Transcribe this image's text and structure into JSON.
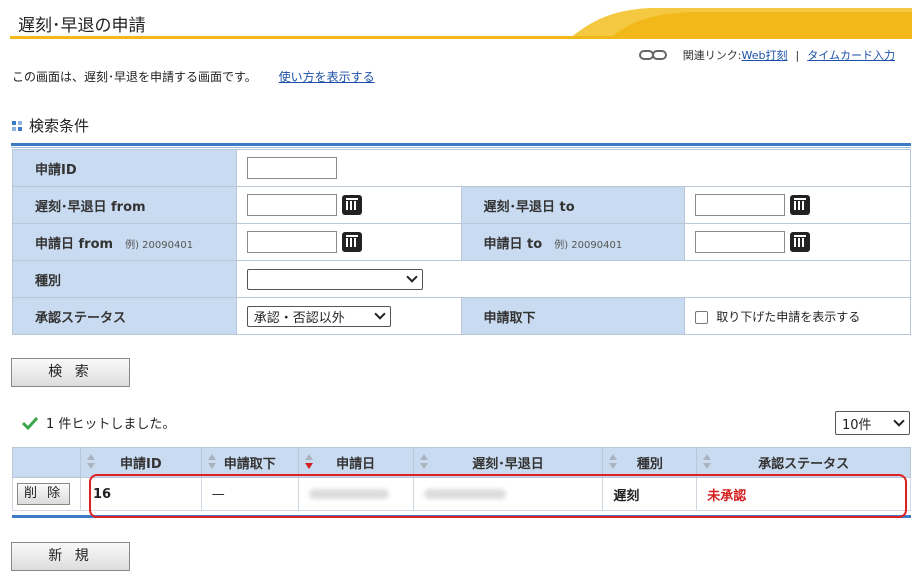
{
  "page": {
    "title": "遅刻･早退の申請",
    "description": "この画面は、遅刻･早退を申請する画面です。",
    "help_link": "使い方を表示する"
  },
  "related": {
    "label": "関連リンク:",
    "links": [
      "Web打刻",
      "タイムカード入力"
    ],
    "separator": "|"
  },
  "search": {
    "heading": "検索条件",
    "fields": {
      "request_id": {
        "label": "申請ID",
        "value": ""
      },
      "late_from": {
        "label": "遅刻･早退日 from",
        "value": ""
      },
      "late_to": {
        "label": "遅刻･早退日 to",
        "value": ""
      },
      "apply_from": {
        "label": "申請日 from",
        "example": "例) 20090401",
        "value": ""
      },
      "apply_to": {
        "label": "申請日 to",
        "example": "例) 20090401",
        "value": ""
      },
      "type": {
        "label": "種別",
        "value": ""
      },
      "status": {
        "label": "承認ステータス",
        "value": "承認・否認以外"
      },
      "withdraw": {
        "label": "申請取下",
        "checkbox_label": "取り下げた申請を表示する",
        "checked": false
      }
    },
    "search_button": "検 索"
  },
  "results": {
    "hit_text": "1 件ヒットしました。",
    "per_page": "10件",
    "columns": [
      "",
      "申請ID",
      "申請取下",
      "申請日",
      "遅刻･早退日",
      "種別",
      "承認ステータス"
    ],
    "rows": [
      {
        "delete_label": "削 除",
        "request_id": "16",
        "withdraw": "—",
        "apply_date": "",
        "late_date": "",
        "type": "遅刻",
        "status": "未承認"
      }
    ],
    "new_button": "新 規"
  },
  "colors": {
    "accent_yellow": "#f2b81a",
    "header_blue": "#c9dbf0",
    "rule_blue": "#3d7ac6",
    "status_red": "#d42020",
    "link_blue": "#1b4fa8"
  }
}
